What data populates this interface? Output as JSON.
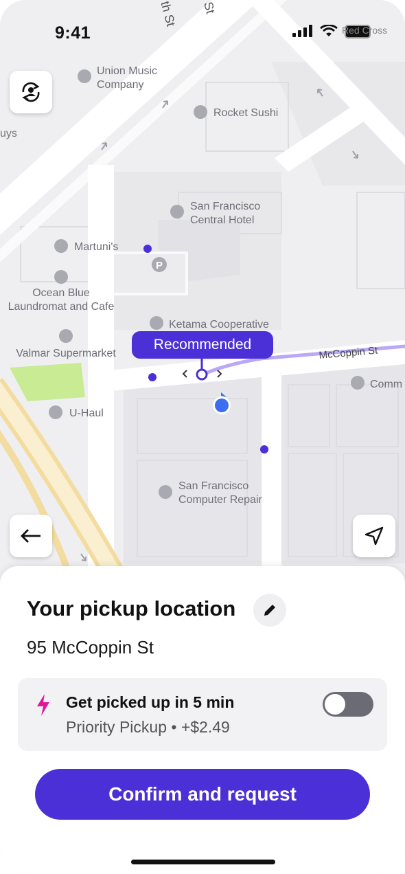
{
  "status_bar": {
    "time": "9:41",
    "carrier_partial": "Red Cross"
  },
  "map": {
    "streets": {
      "top_left": "th St",
      "top_mid": "St",
      "mccoppin": "McCoppin St"
    },
    "pois": [
      {
        "label": "Union Music Company",
        "lines": [
          "Union Music",
          "Company"
        ],
        "icon": "bag-icon"
      },
      {
        "label": "Rocket Sushi",
        "lines": [
          "Rocket Sushi"
        ],
        "icon": "fork-knife-icon"
      },
      {
        "label": "San Francisco Central Hotel",
        "lines": [
          "San Francisco",
          "Central Hotel"
        ],
        "icon": "bed-icon"
      },
      {
        "label": "Martuni's",
        "lines": [
          "Martuni's"
        ],
        "icon": "cocktail-icon"
      },
      {
        "label": "Ocean Blue Laundromat and Cafe",
        "lines": [
          "Ocean Blue",
          "Laundromat and Cafe"
        ],
        "icon": "fork-knife-icon"
      },
      {
        "label": "Ketama Cooperative",
        "lines": [
          "Ketama Cooperative"
        ],
        "icon": "pin-icon"
      },
      {
        "label": "Valmar Supermarket",
        "lines": [
          "Valmar Supermarket"
        ],
        "icon": "bag-icon"
      },
      {
        "label": "U-Haul",
        "lines": [
          "U-Haul"
        ],
        "icon": "pin-icon"
      },
      {
        "label": "San Francisco Computer Repair",
        "lines": [
          "San Francisco",
          "Computer Repair"
        ],
        "icon": "pin-icon"
      },
      {
        "label": "Comm",
        "lines": [
          "Comm"
        ],
        "icon": "pin-icon"
      }
    ],
    "edge_text": "uys",
    "parking_symbol": "P",
    "recommended_label": "Recommended",
    "colors": {
      "route": "#b9a8f5",
      "accent": "#4a30d6",
      "user_dot": "#3b6ef0",
      "park": "#c8eb94"
    }
  },
  "buttons": {
    "switch_rider_icon": "switch-rider-icon",
    "back_icon": "arrow-left-icon",
    "locate_icon": "navigation-arrow-icon"
  },
  "sheet": {
    "title": "Your pickup location",
    "address": "95 McCoppin St",
    "priority": {
      "title": "Get picked up in 5 min",
      "subtitle": "Priority Pickup • +$2.49",
      "enabled": false
    },
    "confirm_label": "Confirm and request"
  }
}
